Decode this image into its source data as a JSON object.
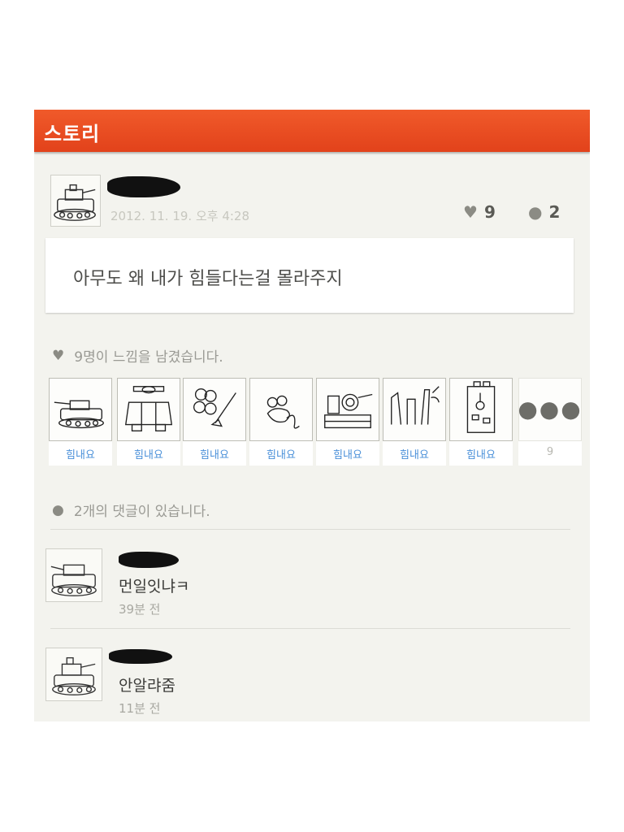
{
  "header": {
    "title": "스토리"
  },
  "post": {
    "date": "2012. 11. 19. 오후 4:28",
    "like_count": "9",
    "comment_count": "2",
    "text": "아무도 왜 내가 힘들다는걸 몰라주지",
    "icons": {
      "like": "heart-icon",
      "comment": "speech-bubble-icon"
    }
  },
  "likes": {
    "summary": "9명이 느낌을 남겼습니다.",
    "items": [
      {
        "label": "힘내요",
        "drawing": "tank-side-drawing"
      },
      {
        "label": "힘내요",
        "drawing": "tank-front-drawing"
      },
      {
        "label": "힘내요",
        "drawing": "scribble-drawing"
      },
      {
        "label": "힘내요",
        "drawing": "mouse-drawing"
      },
      {
        "label": "힘내요",
        "drawing": "tank-turret-drawing"
      },
      {
        "label": "힘내요",
        "drawing": "sketch-drawing"
      },
      {
        "label": "힘내요",
        "drawing": "robot-drawing"
      }
    ],
    "more": {
      "label": "9",
      "icon": "more-dots-icon"
    }
  },
  "comments": {
    "summary": "2개의 댓글이 있습니다.",
    "items": [
      {
        "text": "먼일잇냐ㅋ",
        "time": "39분 전"
      },
      {
        "text": "안알랴줌",
        "time": "11분 전"
      }
    ]
  },
  "colors": {
    "header": "#e9471f",
    "background": "#f3f3ee",
    "link": "#4a90d9"
  }
}
